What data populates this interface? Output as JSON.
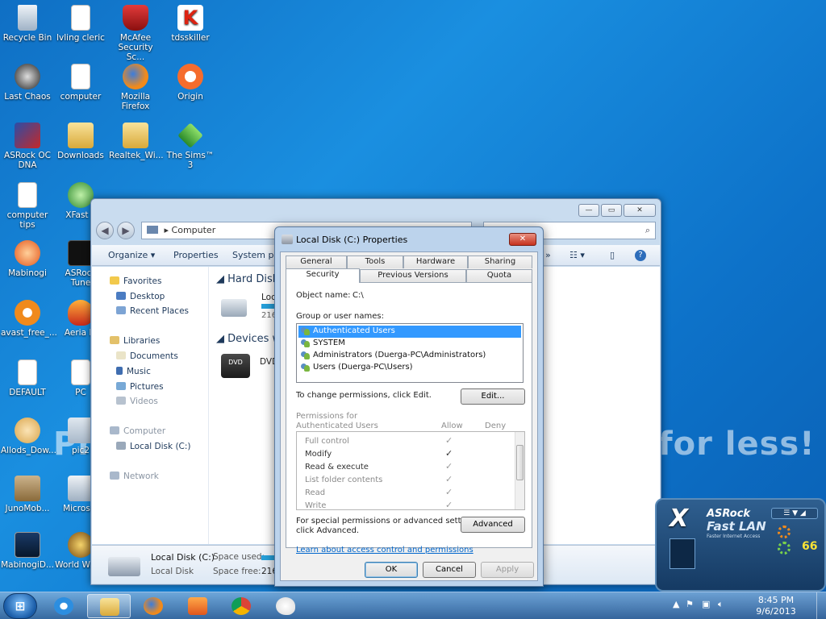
{
  "desktop": {
    "watermark_text": "Protect more of your memories for less!",
    "watermark_brand": "et",
    "icons": [
      {
        "label": "Recycle Bin"
      },
      {
        "label": "lvling cleric"
      },
      {
        "label": "McAfee Security Sc..."
      },
      {
        "label": "tdsskiller"
      },
      {
        "label": "Last Chaos"
      },
      {
        "label": "computer"
      },
      {
        "label": "Mozilla Firefox"
      },
      {
        "label": "Origin"
      },
      {
        "label": "ASRock OC DNA"
      },
      {
        "label": "Downloads"
      },
      {
        "label": "Realtek_Wi..."
      },
      {
        "label": "The Sims™ 3"
      },
      {
        "label": "computer tips"
      },
      {
        "label": "XFast L"
      },
      {
        "label": "Mabinogi"
      },
      {
        "label": "ASRock Tune"
      },
      {
        "label": "avast_free_..."
      },
      {
        "label": "Aeria Ig"
      },
      {
        "label": "DEFAULT"
      },
      {
        "label": "PC"
      },
      {
        "label": "Allods_Dow..."
      },
      {
        "label": "pic2"
      },
      {
        "label": "JunoMob..."
      },
      {
        "label": "Microsof"
      },
      {
        "label": "MabinogiD..."
      },
      {
        "label": "World Warcr"
      }
    ]
  },
  "explorer": {
    "address": "Computer",
    "search_placeholder": "ter",
    "toolbar": {
      "organize": "Organize ▾",
      "properties": "Properties",
      "system": "System pro"
    },
    "nav": {
      "favorites": "Favorites",
      "desktop": "Desktop",
      "recent": "Recent Places",
      "libraries": "Libraries",
      "documents": "Documents",
      "music": "Music",
      "pictures": "Pictures",
      "videos": "Videos",
      "computer": "Computer",
      "local_disk": "Local Disk (C:)",
      "network": "Network"
    },
    "content": {
      "hard_disk_heading": "Hard Disk",
      "disk_name": "Loc",
      "disk_free": "216",
      "devices_heading": "Devices wi",
      "dvd_label": "DVD"
    },
    "details": {
      "name": "Local Disk (C:)",
      "type": "Local Disk",
      "space_used_label": "Space used:",
      "space_free_label": "Space free:",
      "space_free_value": "216"
    }
  },
  "dialog": {
    "title": "Local Disk (C:) Properties",
    "tabs_row1": [
      "General",
      "Tools",
      "Hardware",
      "Sharing"
    ],
    "tabs_row2": [
      "Security",
      "Previous Versions",
      "Quota"
    ],
    "object_name_label": "Object name:",
    "object_name_value": "C:\\",
    "group_label": "Group or user names:",
    "users": [
      "Authenticated Users",
      "SYSTEM",
      "Administrators (Duerga-PC\\Administrators)",
      "Users (Duerga-PC\\Users)"
    ],
    "change_perm_text": "To change permissions, click Edit.",
    "edit_button": "Edit...",
    "perm_for_label": "Permissions for Authenticated Users",
    "allow_label": "Allow",
    "deny_label": "Deny",
    "permissions": [
      {
        "name": "Full control",
        "allow": "✓"
      },
      {
        "name": "Modify",
        "allow": "✓"
      },
      {
        "name": "Read & execute",
        "allow": "✓"
      },
      {
        "name": "List folder contents",
        "allow": "✓"
      },
      {
        "name": "Read",
        "allow": "✓"
      },
      {
        "name": "Write",
        "allow": "✓"
      }
    ],
    "special_text_1": "For special permissions or advanced settings,",
    "special_text_2": "click Advanced.",
    "advanced_button": "Advanced",
    "learn_link": "Learn about access control and permissions",
    "ok_button": "OK",
    "cancel_button": "Cancel",
    "apply_button": "Apply"
  },
  "widget": {
    "brand_x": "X",
    "brand_name": "ASRock",
    "product": "Fast LAN",
    "tagline": "Faster Internet Access",
    "value": "66"
  },
  "taskbar": {
    "start_label": "⊞",
    "time": "8:45 PM",
    "date": "9/6/2013"
  }
}
